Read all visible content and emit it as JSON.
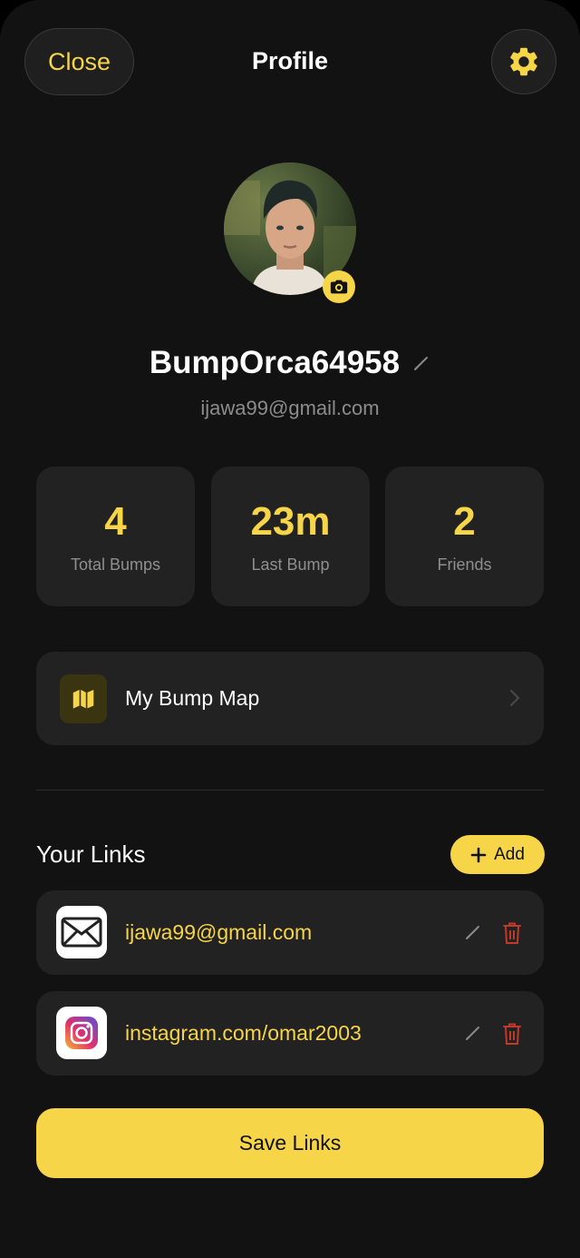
{
  "header": {
    "close_label": "Close",
    "title": "Profile",
    "settings_icon": "gear-icon"
  },
  "profile": {
    "username": "BumpOrca64958",
    "email": "ijawa99@gmail.com"
  },
  "stats": [
    {
      "value": "4",
      "label": "Total Bumps"
    },
    {
      "value": "23m",
      "label": "Last Bump"
    },
    {
      "value": "2",
      "label": "Friends"
    }
  ],
  "map": {
    "label": "My Bump Map"
  },
  "links": {
    "title": "Your Links",
    "add_label": "Add",
    "items": [
      {
        "text": "ijawa99@gmail.com",
        "icon": "mail-icon"
      },
      {
        "text": "instagram.com/omar2003",
        "icon": "instagram-icon"
      }
    ]
  },
  "save_label": "Save Links",
  "colors": {
    "accent": "#f6d548",
    "background": "#121212",
    "card": "#222222",
    "danger": "#c0392b"
  }
}
